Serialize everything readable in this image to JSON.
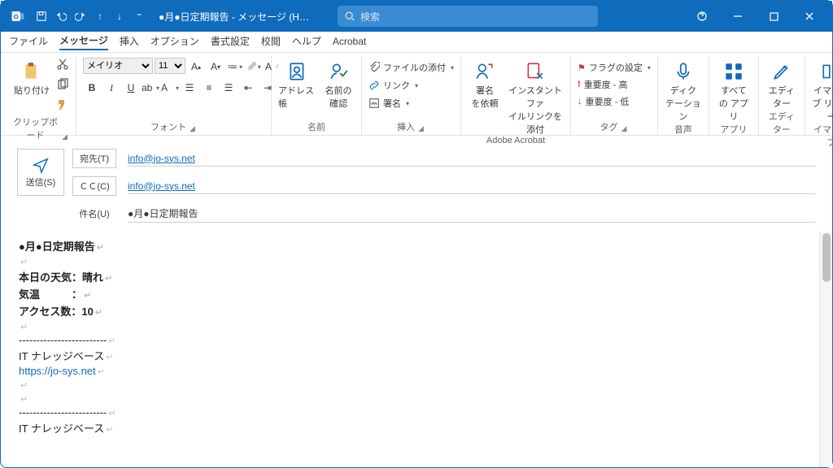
{
  "titlebar": {
    "window_title": "●月●日定期報告 - メッセージ (HTML…",
    "search_placeholder": "検索"
  },
  "tabs": {
    "file": "ファイル",
    "message": "メッセージ",
    "insert": "挿入",
    "options": "オプション",
    "format": "書式設定",
    "review": "校閲",
    "help": "ヘルプ",
    "acrobat": "Acrobat"
  },
  "ribbon": {
    "clipboard": {
      "paste": "貼り付け",
      "label": "クリップボード"
    },
    "font": {
      "family": "メイリオ",
      "size": "11",
      "label": "フォント"
    },
    "names": {
      "address_book": "アドレス帳",
      "check_names": "名前の\n確認",
      "label": "名前"
    },
    "insert": {
      "attach": "ファイルの添付",
      "link": "リンク",
      "signature": "署名",
      "label": "挿入"
    },
    "acrobat": {
      "req_sig": "署名\nを依頼",
      "instant": "インスタントファ\nイルリンクを添付",
      "label": "Adobe Acrobat"
    },
    "tags": {
      "flag": "フラグの設定",
      "high": "重要度 - 高",
      "low": "重要度 - 低",
      "label": "タグ"
    },
    "voice": {
      "dictate": "ディク\nテーション",
      "label": "音声"
    },
    "apps": {
      "all": "すべて\nの アプリ",
      "label": "アプリ"
    },
    "editor": {
      "editor": "エディ\nター",
      "label": "エディター"
    },
    "immersive": {
      "reader": "イマーシ\nブ リーダー",
      "label": "イマーシブ"
    }
  },
  "header": {
    "send": "送信(S)",
    "to_label": "宛先(T)",
    "cc_label": "ＣＣ(C)",
    "subject_label": "件名(U)",
    "to_value": "info@jo-sys.net",
    "cc_value": "info@jo-sys.net",
    "subject_value": "●月●日定期報告"
  },
  "body": {
    "l1": "●月●日定期報告",
    "l2": "本日の天気：晴れ",
    "l3": "気温　　　：",
    "l4": "アクセス数：10",
    "sep": "-------------------------",
    "sig1": "IT ナレッジベース",
    "url": "https://jo-sys.net",
    "sig2": "IT ナレッジベース"
  }
}
